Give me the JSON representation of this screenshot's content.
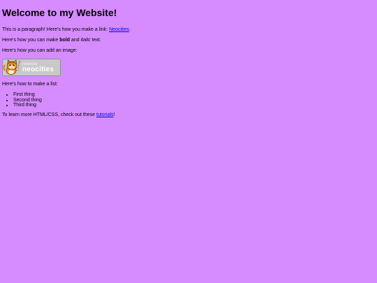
{
  "heading": "Welcome to my Website!",
  "para1": {
    "before": "This is a paragraph! Here's how you make a link: ",
    "link": "Neocities",
    "after": "."
  },
  "para2": {
    "before": "Here's how you can make ",
    "bold": "bold",
    "middle": " and ",
    "italic": "italic",
    "after": " text."
  },
  "para3": "Here's how you can add an image:",
  "badge": {
    "small": "hosted by",
    "big": "neocities",
    "icon": "neocities-cat-icon"
  },
  "para4": "Here's how to make a list:",
  "list": [
    "First thing",
    "Second thing",
    "Third thing"
  ],
  "para5": {
    "before": "To learn more HTML/CSS, check out these ",
    "link": "tutorials",
    "after": "!"
  },
  "colors": {
    "background": "#d68cff",
    "link": "#0000ee"
  }
}
